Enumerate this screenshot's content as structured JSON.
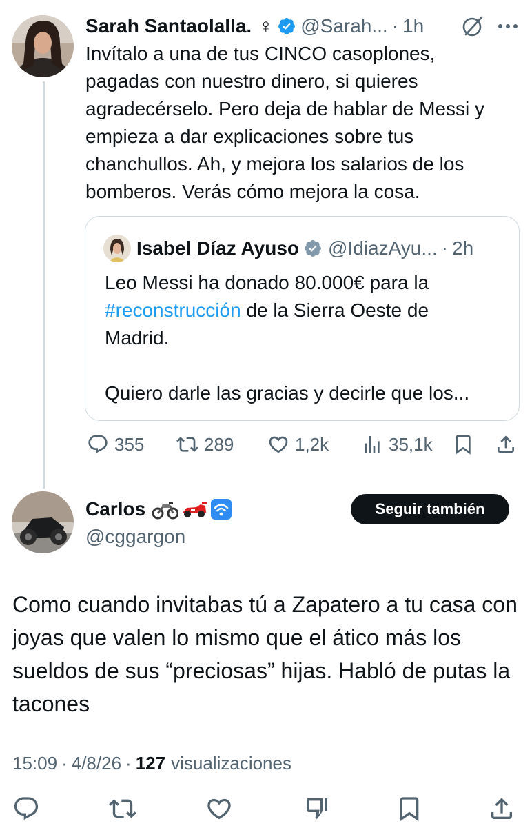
{
  "parent_tweet": {
    "author_name": "Sarah Santaolalla.",
    "gender_symbol": "♀",
    "handle": "@Sarah...",
    "separator": "·",
    "time": "1h",
    "text": "Invítalo a una de tus CINCO casoplones,\npagadas con nuestro dinero, si quieres\nagradecérselo. Pero deja de hablar de Messi y\nempieza a dar explicaciones sobre tus\nchanchullos. Ah, y mejora los salarios de los\nbomberos. Verás cómo mejora la cosa.",
    "quote": {
      "author_name": "Isabel Díaz Ayuso",
      "handle": "@IdiazAyu...",
      "separator": "·",
      "time": "2h",
      "text_before": "Leo Messi ha donado 80.000€ para la",
      "hashtag": "#reconstrucción",
      "text_after": " de la Sierra Oeste de",
      "text_line3": "Madrid.",
      "text_line4": "Quiero darle las gracias y decirle que los..."
    },
    "stats": {
      "replies": "355",
      "reposts": "289",
      "likes": "1,2k",
      "views": "35,1k"
    },
    "icons": [
      "verified-badge-icon",
      "grok-icon",
      "more-icon",
      "reply-icon",
      "repost-icon",
      "like-icon",
      "views-icon",
      "bookmark-icon",
      "share-icon"
    ]
  },
  "reply": {
    "author_name": "Carlos",
    "name_emojis": [
      "motorcycle",
      "racing-car",
      "wifi"
    ],
    "handle": "@cggargon",
    "follow_button_label": "Seguir también",
    "text": "Como cuando invitabas tú a Zapatero a tu casa con joyas que valen lo mismo que el ático más los sueldos de sus “preciosas” hijas. Habló de putas la tacones",
    "time": "15:09",
    "separator": "·",
    "date": "4/8/26",
    "views_count": "127",
    "views_label": "visualizaciones"
  },
  "bottom_bar": {
    "icons": [
      "reply-icon",
      "repost-icon",
      "like-icon",
      "dislike-icon",
      "bookmark-icon",
      "share-icon"
    ]
  },
  "colors": {
    "text": "#0f1419",
    "secondary": "#536471",
    "link": "#1d9bf0",
    "border": "#cfd9de",
    "button_bg": "#0f1419"
  }
}
